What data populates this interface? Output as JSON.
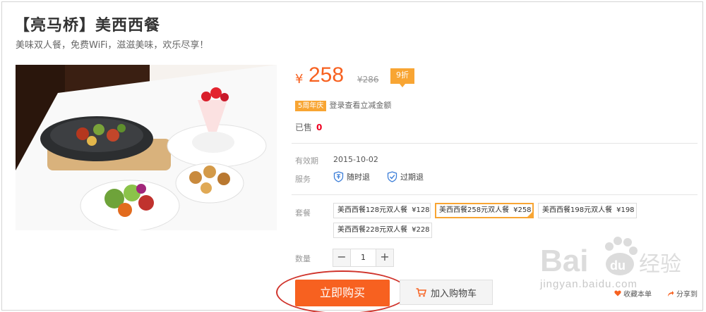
{
  "header": {
    "title": "【亮马桥】美西西餐",
    "subtitle": "美味双人餐，免费WiFi，滋滋美味，欢乐尽享！"
  },
  "price": {
    "symbol": "¥",
    "current": "258",
    "original": "¥286",
    "discount_badge": "9折"
  },
  "promo": {
    "badge": "5周年庆",
    "text": "登录查看立减金额"
  },
  "sold": {
    "label": "已售",
    "count": "0"
  },
  "validity": {
    "label": "有效期",
    "value": "2015-10-02"
  },
  "service": {
    "label": "服务",
    "items": [
      {
        "label": "随时退",
        "icon": "refund-anytime-icon"
      },
      {
        "label": "过期退",
        "icon": "refund-expired-icon"
      }
    ]
  },
  "packages": {
    "label": "套餐",
    "items": [
      {
        "name": "美西西餐128元双人餐",
        "price": "¥128",
        "selected": false
      },
      {
        "name": "美西西餐258元双人餐",
        "price": "¥258",
        "selected": true
      },
      {
        "name": "美西西餐198元双人餐",
        "price": "¥198",
        "selected": false
      },
      {
        "name": "美西西餐228元双人餐",
        "price": "¥228",
        "selected": false
      }
    ]
  },
  "quantity": {
    "label": "数量",
    "value": "1",
    "minus": "−",
    "plus": "+"
  },
  "actions": {
    "buy": "立即购买",
    "cart": "加入购物车",
    "favorite": "收藏本单",
    "share": "分享到"
  },
  "watermark": {
    "text": "jingyan.baidu.com",
    "logo": "Bai du 经验"
  },
  "colors": {
    "accent": "#f76120",
    "badge": "#f8a533",
    "annotation": "#d0342c"
  }
}
